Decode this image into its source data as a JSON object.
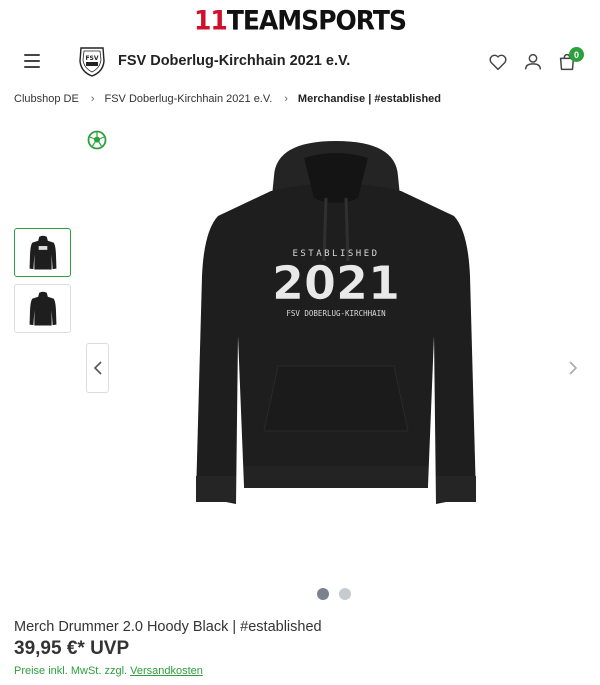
{
  "brand": {
    "logo_num": "11",
    "logo_word": "TEAMSPORTS"
  },
  "header": {
    "club_name": "FSV Doberlug-Kirchhain 2021 e.V.",
    "cart_count": "0",
    "icons": [
      "menu-icon",
      "heart-icon",
      "user-icon",
      "cart-icon"
    ]
  },
  "breadcrumb": {
    "items": [
      "Clubshop DE",
      "FSV Doberlug-Kirchhain 2021 e.V."
    ],
    "current": "Merchandise | #established"
  },
  "gallery": {
    "print_line1": "ESTABLISHED",
    "print_year": "2021",
    "print_line2": "FSV DOBERLUG-KIRCHHAIN",
    "thumbnail_count": 2,
    "active_slide": 1,
    "slide_count": 2
  },
  "product": {
    "title": "Merch Drummer 2.0 Hoody Black | #established",
    "price": "39,95 €* UVP",
    "tax_prefix": "Preise inkl. MwSt. zzgl. ",
    "tax_link": "Versandkosten"
  },
  "colors": {
    "accent_green": "#2e9f3d",
    "brand_red": "#d0112b",
    "hoodie": "#1e1e1f"
  }
}
